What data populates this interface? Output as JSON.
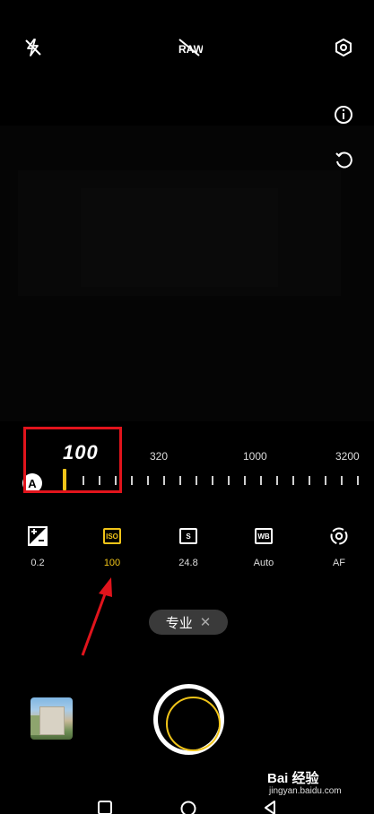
{
  "top_bar": {
    "flash_icon": "flash-off-icon",
    "raw_icon": "raw-icon",
    "settings_icon": "settings-icon"
  },
  "side_controls": {
    "info_icon": "info-icon",
    "reset_icon": "reset-icon"
  },
  "iso_scale": {
    "current_value": "100",
    "auto_label": "A",
    "tick_labels": [
      "320",
      "1000",
      "3200"
    ]
  },
  "pro_modes": [
    {
      "id": "ev",
      "icon": "exposure-icon",
      "label": "0.2",
      "active": false
    },
    {
      "id": "iso",
      "icon_text": "ISO",
      "label": "100",
      "active": true
    },
    {
      "id": "s",
      "icon_text": "S",
      "label": "24.8",
      "active": false
    },
    {
      "id": "wb",
      "icon_text": "WB",
      "label": "Auto",
      "active": false
    },
    {
      "id": "af",
      "icon": "focus-icon",
      "label": "AF",
      "active": false
    }
  ],
  "mode_chip": {
    "label": "专业",
    "close": "✕"
  },
  "bottom": {
    "gallery": "gallery-thumbnail",
    "shutter": "shutter-button"
  },
  "navbar": {
    "square": "recent-apps-icon",
    "circle": "home-icon",
    "triangle": "back-icon"
  },
  "watermark": {
    "main": "Bai 经验",
    "sub": "jingyan.baidu.com"
  },
  "colors": {
    "accent": "#f0c419",
    "highlight": "#e1141c",
    "background": "#000000"
  }
}
